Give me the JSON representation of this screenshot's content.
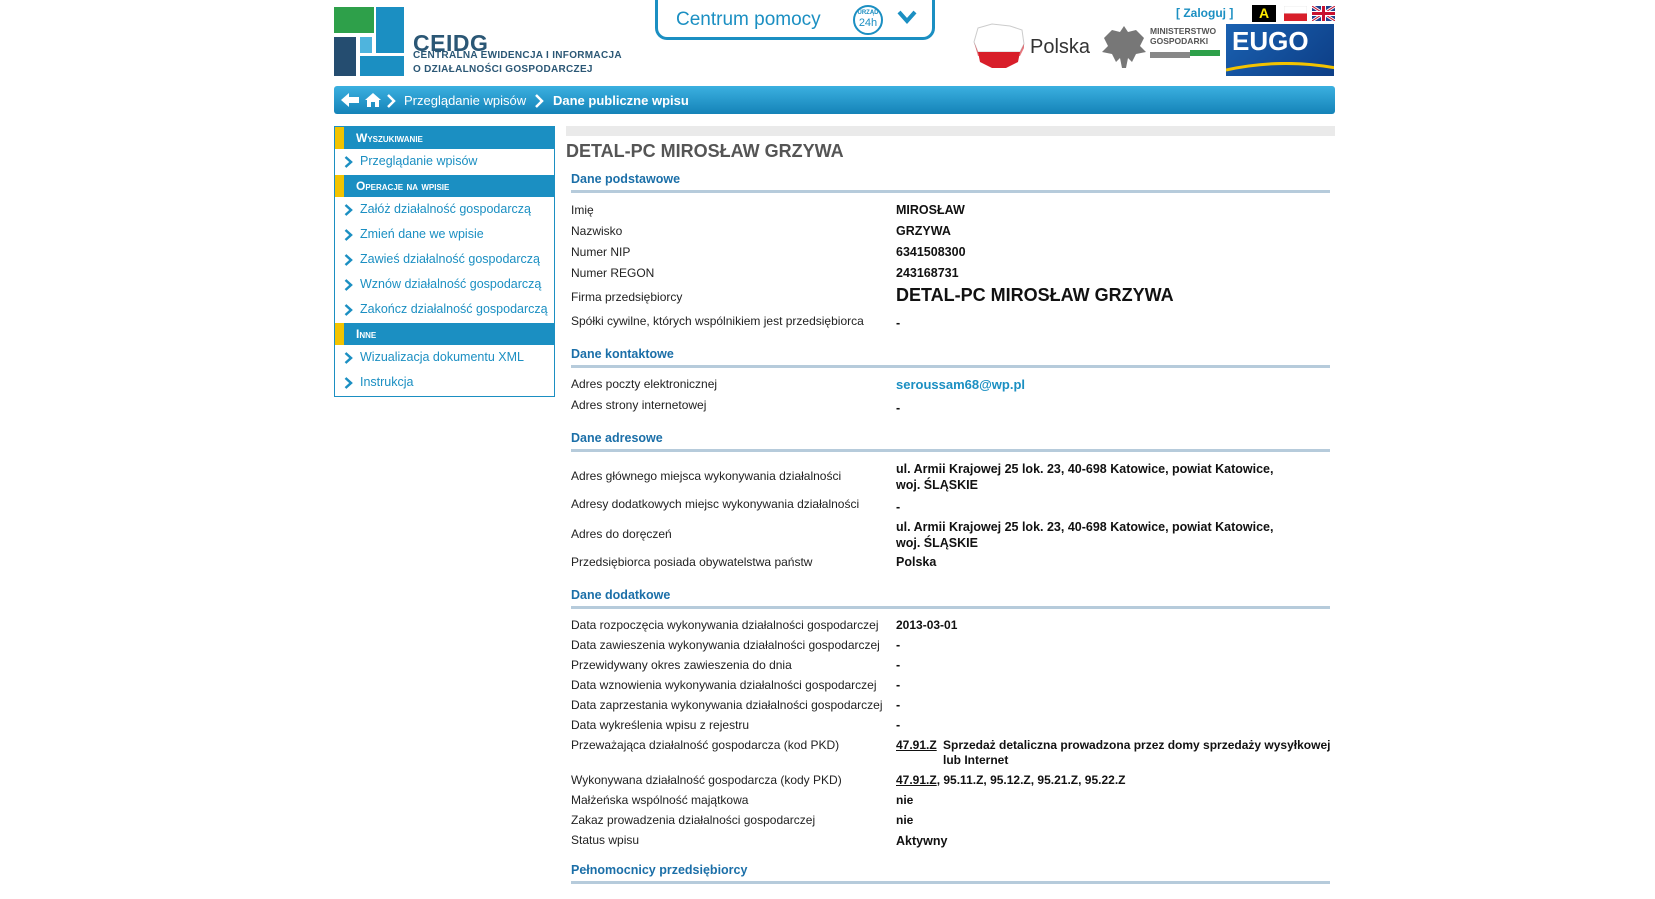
{
  "header": {
    "logo_title": "CEIDG",
    "logo_sub_line1": "CENTRALNA EWIDENCJA I INFORMACJA",
    "logo_sub_line2": "O DZIAŁALNOŚCI GOSPODARCZEJ",
    "help_label": "Centrum pomocy",
    "help_badge_top": "URZĄD",
    "help_badge_main": "24h",
    "country_label": "Polska",
    "ministry_line1": "MINISTERSTWO",
    "ministry_line2": "GOSPODARKI",
    "eugo_label": "EUGO",
    "login_label": "[ Zaloguj ]",
    "contrast_label": "A"
  },
  "breadcrumb": {
    "item1": "Przeglądanie wpisów",
    "item2": "Dane publiczne wpisu"
  },
  "sidebar": {
    "sections": [
      {
        "title": "Wyszukiwanie",
        "items": [
          "Przeglądanie wpisów"
        ]
      },
      {
        "title": "Operacje na wpisie",
        "items": [
          "Załóż działalność gospodarczą",
          "Zmień dane we wpisie",
          "Zawieś działalność gospodarczą",
          "Wznów działalność gospodarczą",
          "Zakończ działalność gospodarczą"
        ]
      },
      {
        "title": "Inne",
        "items": [
          "Wizualizacja dokumentu XML",
          "Instrukcja"
        ]
      }
    ]
  },
  "main": {
    "title": "DETAL-PC MIROSŁAW GRZYWA",
    "basic": {
      "heading": "Dane podstawowe",
      "imie_label": "Imię",
      "imie": "MIROSŁAW",
      "nazwisko_label": "Nazwisko",
      "nazwisko": "GRZYWA",
      "nip_label": "Numer NIP",
      "nip": "6341508300",
      "regon_label": "Numer REGON",
      "regon": "243168731",
      "firma_label": "Firma przedsiębiorcy",
      "firma": "DETAL-PC MIROSŁAW GRZYWA",
      "spolki_label": "Spółki cywilne, których wspólnikiem jest przedsiębiorca",
      "spolki": "-"
    },
    "contact": {
      "heading": "Dane kontaktowe",
      "email_label": "Adres poczty elektronicznej",
      "email": "seroussam68@wp.pl",
      "www_label": "Adres strony internetowej",
      "www": "-"
    },
    "address": {
      "heading": "Dane adresowe",
      "main_label": "Adres głównego miejsca wykonywania działalności",
      "main_line1": "ul. Armii Krajowej 25 lok. 23, 40-698 Katowice, powiat Katowice,",
      "main_line2": "woj. ŚLĄSKIE",
      "extra_label": "Adresy dodatkowych miejsc wykonywania działalności",
      "extra": "-",
      "delivery_label": "Adres do doręczeń",
      "delivery_line1": "ul. Armii Krajowej 25 lok. 23, 40-698 Katowice, powiat Katowice,",
      "delivery_line2": "woj. ŚLĄSKIE",
      "citizenship_label": "Przedsiębiorca posiada obywatelstwa państw",
      "citizenship": "Polska"
    },
    "extra": {
      "heading": "Dane dodatkowe",
      "start_label": "Data rozpoczęcia wykonywania działalności gospodarczej",
      "start": "2013-03-01",
      "suspend_label": "Data zawieszenia wykonywania działalności gospodarczej",
      "suspend": "-",
      "suspend_period_label": "Przewidywany okres zawieszenia do dnia",
      "suspend_period": "-",
      "resume_label": "Data wznowienia wykonywania działalności gospodarczej",
      "resume": "-",
      "end_label": "Data zaprzestania wykonywania działalności gospodarczej",
      "end": "-",
      "removed_label": "Data wykreślenia wpisu z rejestru",
      "removed": "-",
      "main_pkd_label": "Przeważająca działalność gospodarcza (kod PKD)",
      "main_pkd_code": "47.91.Z",
      "main_pkd_desc_line1": "Sprzedaż detaliczna prowadzona przez domy sprzedaży wysyłkowej",
      "main_pkd_desc_line2": "lub Internet",
      "pkd_label": "Wykonywana działalność gospodarcza (kody PKD)",
      "pkd_first": "47.91.Z",
      "pkd_rest": ", 95.11.Z, 95.12.Z, 95.21.Z, 95.22.Z",
      "marital_label": "Małżeńska wspólność majątkowa",
      "marital": "nie",
      "ban_label": "Zakaz prowadzenia działalności gospodarczej",
      "ban": "nie",
      "status_label": "Status wpisu",
      "status": "Aktywny"
    },
    "proxies": {
      "heading": "Pełnomocnicy przedsiębiorcy"
    }
  }
}
